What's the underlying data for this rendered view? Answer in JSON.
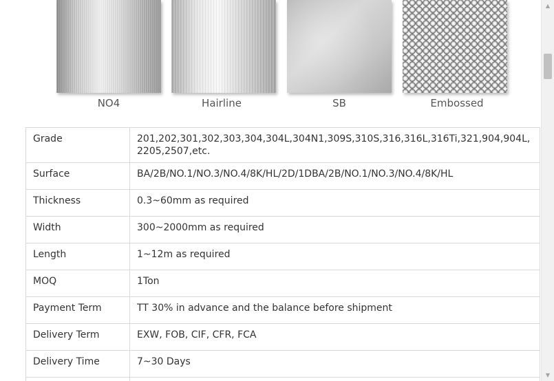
{
  "swatches": [
    {
      "label": "NO4"
    },
    {
      "label": "Hairline"
    },
    {
      "label": "SB"
    },
    {
      "label": "Embossed"
    }
  ],
  "spec_rows": [
    {
      "key": "Grade",
      "value": "201,202,301,302,303,304,304L,304N1,309S,310S,316,316L,316Ti,321,904,904L,2205,2507,etc."
    },
    {
      "key": "Surface",
      "value": "BA/2B/NO.1/NO.3/NO.4/8K/HL/2D/1DBA/2B/NO.1/NO.3/NO.4/8K/HL"
    },
    {
      "key": "Thickness",
      "value": "0.3~60mm as required"
    },
    {
      "key": "Width",
      "value": "300~2000mm as required"
    },
    {
      "key": "Length",
      "value": "1~12m as required"
    },
    {
      "key": "MOQ",
      "value": "1Ton"
    },
    {
      "key": "Payment Term",
      "value": "TT 30% in advance and the balance before shipment"
    },
    {
      "key": "Delivery Term",
      "value": "EXW, FOB, CIF, CFR, FCA"
    },
    {
      "key": "Delivery Time",
      "value": "7~30 Days"
    }
  ],
  "scrollbar": {
    "up_icon": "triangle-up-icon",
    "down_icon": "triangle-down-icon"
  },
  "colors": {
    "border": "#d9d9d9",
    "text": "#333333",
    "label": "#555555",
    "scroll_track": "#f1f1f1",
    "scroll_thumb": "#c1c1c1"
  }
}
